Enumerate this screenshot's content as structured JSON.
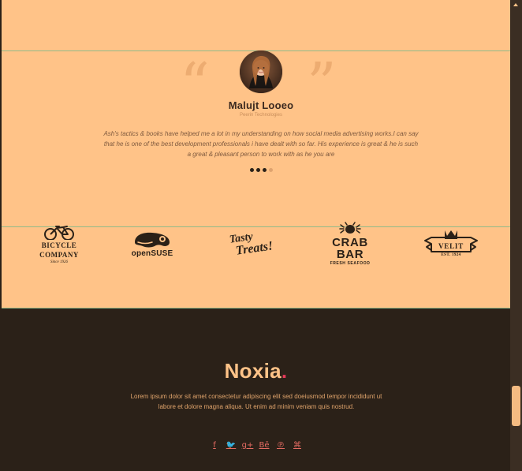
{
  "testimonial": {
    "name": "Malujt Looeo",
    "company": "Peerin Technologies",
    "text": "Ash's tactics & books have helped me a lot in my understanding on how social media advertising works.I can say that he is one of the best development professionals i have dealt with so far. His experience is great & he is such a great & pleasant person to work with as he you are",
    "dots_count": 4,
    "active_dot_index": 0,
    "quote_left_glyph": "“",
    "quote_right_glyph": "”"
  },
  "partners": {
    "bicycle": {
      "line1": "BICYCLE",
      "line2": "COMPANY",
      "line3": "Since 1926"
    },
    "opensuse": {
      "text": "openSUSE"
    },
    "tasty": {
      "line1": "Tasty",
      "line2": "Treats!"
    },
    "crabbar": {
      "line1": "CRAB BAR",
      "line2": "FRESH SEAFOOD"
    },
    "velit": {
      "line1": "VELIT",
      "line2": "EST. 1924"
    }
  },
  "footer": {
    "brand": "Noxia",
    "brand_accent": ".",
    "text": "Lorem ipsum dolor sit amet consectetur adipiscing elit sed doeiusmod tempor incididunt ut labore et dolore magna aliqua. Ut enim ad minim veniam quis nostrud.",
    "social": [
      {
        "name": "facebook-icon",
        "glyph": "f"
      },
      {
        "name": "twitter-icon",
        "glyph": "🐦"
      },
      {
        "name": "google-plus-icon",
        "glyph": "g+"
      },
      {
        "name": "behance-icon",
        "glyph": "Bē"
      },
      {
        "name": "pinterest-icon",
        "glyph": "℗"
      },
      {
        "name": "instagram-icon",
        "glyph": "⌘"
      }
    ]
  },
  "colors": {
    "peach_bg": "#ffc388",
    "footer_bg": "#2b2118",
    "accent": "#e6395b",
    "icon_color": "#e46b62",
    "divider": "#7fb88a"
  }
}
